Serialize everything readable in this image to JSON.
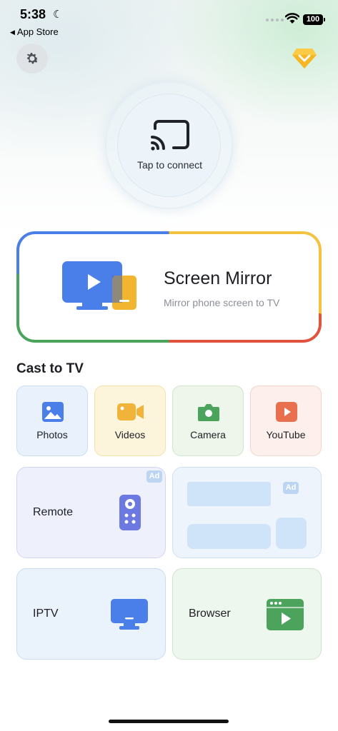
{
  "status_bar": {
    "time": "5:38",
    "back_label": "App Store",
    "battery": "100"
  },
  "connect": {
    "label": "Tap to connect"
  },
  "screen_mirror": {
    "title": "Screen Mirror",
    "subtitle": "Mirror phone screen to TV"
  },
  "cast": {
    "section_title": "Cast to TV",
    "tiles": [
      {
        "label": "Photos",
        "icon": "photos-icon",
        "color": "#4a7ee8"
      },
      {
        "label": "Videos",
        "icon": "video-camera-icon",
        "color": "#f0b43a"
      },
      {
        "label": "Camera",
        "icon": "camera-icon",
        "color": "#4ca35c"
      },
      {
        "label": "YouTube",
        "icon": "play-icon",
        "color": "#e8704f"
      }
    ]
  },
  "features": {
    "remote_label": "Remote",
    "iptv_label": "IPTV",
    "browser_label": "Browser",
    "ad_label": "Ad"
  },
  "colors": {
    "brand_blue": "#4a7ee8",
    "brand_green": "#4ca35c",
    "brand_yellow": "#f1c33f",
    "brand_red": "#e0533f"
  }
}
